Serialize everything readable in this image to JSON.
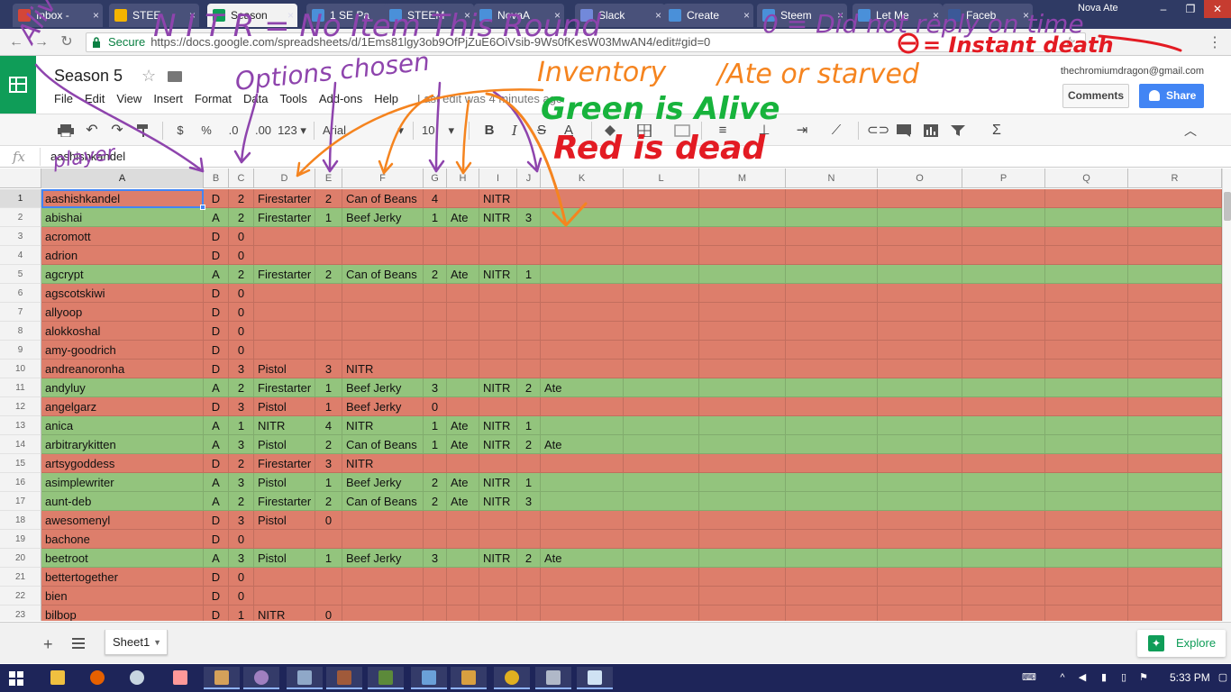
{
  "browser": {
    "tabs": [
      {
        "label": "Inbox -",
        "color": "#d44638"
      },
      {
        "label": "STEE",
        "color": "#f4b400"
      },
      {
        "label": "Season",
        "color": "#0f9d58"
      },
      {
        "label": "1 SE Pa",
        "color": "#4a90d9"
      },
      {
        "label": "STEEM",
        "color": "#4a90d9"
      },
      {
        "label": "NovaA",
        "color": "#4a90d9"
      },
      {
        "label": "Slack",
        "color": "#7289da"
      },
      {
        "label": "Create",
        "color": "#4a90d9"
      },
      {
        "label": "Steem",
        "color": "#4a90d9"
      },
      {
        "label": "Let Me",
        "color": "#4a90d9"
      },
      {
        "label": "Faceb",
        "color": "#3b5998"
      }
    ],
    "window_user": "Nova Ate",
    "secure_label": "Secure",
    "url": "https://docs.google.com/spreadsheets/d/1Ems81lgy3ob9OfPjZuE6OiVsib-9Ws0fKesW03MwAN4/edit#gid=0"
  },
  "docs": {
    "title": "Season 5",
    "menu": [
      "File",
      "Edit",
      "View",
      "Insert",
      "Format",
      "Data",
      "Tools",
      "Add-ons",
      "Help"
    ],
    "last_edit": "Last edit was 4 minutes ago",
    "account": "thechromiumdragon@gmail.com",
    "comments_label": "Comments",
    "share_label": "Share"
  },
  "toolbar": {
    "currency": "$",
    "percent": "%",
    "dec_less": ".0",
    "dec_more": ".00",
    "number_format": "123",
    "font": "Arial",
    "font_size": "10",
    "bold": "B"
  },
  "formula": {
    "fx": "fx",
    "value": "aashishkandel"
  },
  "grid": {
    "columns": [
      "A",
      "B",
      "C",
      "D",
      "E",
      "F",
      "G",
      "H",
      "I",
      "J",
      "K",
      "L",
      "M",
      "N",
      "O",
      "P",
      "Q",
      "R"
    ],
    "colors": {
      "alive": "#93c47d",
      "dead": "#dd7e6b"
    },
    "rows": [
      {
        "n": "1",
        "status": "dead",
        "cells": [
          "aashishkandel",
          "D",
          "2",
          "Firestarter",
          "2",
          "Can of Beans",
          "4",
          "",
          "NITR",
          "",
          ""
        ]
      },
      {
        "n": "2",
        "status": "alive",
        "cells": [
          "abishai",
          "A",
          "2",
          "Firestarter",
          "1",
          "Beef Jerky",
          "1",
          "Ate",
          "NITR",
          "3",
          ""
        ]
      },
      {
        "n": "3",
        "status": "dead",
        "cells": [
          "acromott",
          "D",
          "0",
          "",
          "",
          "",
          "",
          "",
          "",
          "",
          ""
        ]
      },
      {
        "n": "4",
        "status": "dead",
        "cells": [
          "adrion",
          "D",
          "0",
          "",
          "",
          "",
          "",
          "",
          "",
          "",
          ""
        ]
      },
      {
        "n": "5",
        "status": "alive",
        "cells": [
          "agcrypt",
          "A",
          "2",
          "Firestarter",
          "2",
          "Can of Beans",
          "2",
          "Ate",
          "NITR",
          "1",
          ""
        ]
      },
      {
        "n": "6",
        "status": "dead",
        "cells": [
          "agscotskiwi",
          "D",
          "0",
          "",
          "",
          "",
          "",
          "",
          "",
          "",
          ""
        ]
      },
      {
        "n": "7",
        "status": "dead",
        "cells": [
          "allyoop",
          "D",
          "0",
          "",
          "",
          "",
          "",
          "",
          "",
          "",
          ""
        ]
      },
      {
        "n": "8",
        "status": "dead",
        "cells": [
          "alokkoshal",
          "D",
          "0",
          "",
          "",
          "",
          "",
          "",
          "",
          "",
          ""
        ]
      },
      {
        "n": "9",
        "status": "dead",
        "cells": [
          "amy-goodrich",
          "D",
          "0",
          "",
          "",
          "",
          "",
          "",
          "",
          "",
          ""
        ]
      },
      {
        "n": "10",
        "status": "dead",
        "cells": [
          "andreanoronha",
          "D",
          "3",
          "Pistol",
          "3",
          "NITR",
          "",
          "",
          "",
          "",
          ""
        ]
      },
      {
        "n": "11",
        "status": "alive",
        "cells": [
          "andyluy",
          "A",
          "2",
          "Firestarter",
          "1",
          "Beef Jerky",
          "3",
          "",
          "NITR",
          "2",
          "Ate"
        ]
      },
      {
        "n": "12",
        "status": "dead",
        "cells": [
          "angelgarz",
          "D",
          "3",
          "Pistol",
          "1",
          "Beef Jerky",
          "0",
          "",
          "",
          "",
          ""
        ]
      },
      {
        "n": "13",
        "status": "alive",
        "cells": [
          "anica",
          "A",
          "1",
          "NITR",
          "4",
          "NITR",
          "1",
          "Ate",
          "NITR",
          "1",
          ""
        ]
      },
      {
        "n": "14",
        "status": "alive",
        "cells": [
          "arbitrarykitten",
          "A",
          "3",
          "Pistol",
          "2",
          "Can of Beans",
          "1",
          "Ate",
          "NITR",
          "2",
          "Ate"
        ]
      },
      {
        "n": "15",
        "status": "dead",
        "cells": [
          "artsygoddess",
          "D",
          "2",
          "Firestarter",
          "3",
          "NITR",
          "",
          "",
          "",
          "",
          ""
        ]
      },
      {
        "n": "16",
        "status": "alive",
        "cells": [
          "asimplewriter",
          "A",
          "3",
          "Pistol",
          "1",
          "Beef Jerky",
          "2",
          "Ate",
          "NITR",
          "1",
          ""
        ]
      },
      {
        "n": "17",
        "status": "alive",
        "cells": [
          "aunt-deb",
          "A",
          "2",
          "Firestarter",
          "2",
          "Can of Beans",
          "2",
          "Ate",
          "NITR",
          "3",
          ""
        ]
      },
      {
        "n": "18",
        "status": "dead",
        "cells": [
          "awesomenyl",
          "D",
          "3",
          "Pistol",
          "0",
          "",
          "",
          "",
          "",
          "",
          ""
        ]
      },
      {
        "n": "19",
        "status": "dead",
        "cells": [
          "bachone",
          "D",
          "0",
          "",
          "",
          "",
          "",
          "",
          "",
          "",
          ""
        ]
      },
      {
        "n": "20",
        "status": "alive",
        "cells": [
          "beetroot",
          "A",
          "3",
          "Pistol",
          "1",
          "Beef Jerky",
          "3",
          "",
          "NITR",
          "2",
          "Ate"
        ]
      },
      {
        "n": "21",
        "status": "dead",
        "cells": [
          "bettertogether",
          "D",
          "0",
          "",
          "",
          "",
          "",
          "",
          "",
          "",
          ""
        ]
      },
      {
        "n": "22",
        "status": "dead",
        "cells": [
          "bien",
          "D",
          "0",
          "",
          "",
          "",
          "",
          "",
          "",
          "",
          ""
        ]
      },
      {
        "n": "23",
        "status": "dead",
        "cells": [
          "bilbop",
          "D",
          "1",
          "NITR",
          "0",
          "",
          "",
          "",
          "",
          "",
          ""
        ]
      }
    ]
  },
  "sheetbar": {
    "sheet_name": "Sheet1",
    "explore_label": "Explore"
  },
  "taskbar": {
    "clock": "5:33 PM"
  },
  "annotations": {
    "alive_dead": "Alive or Dead",
    "player": "player",
    "nitr": "N I T R = No Item This Round",
    "options": "Options chosen",
    "zero": "0 = Did not reply on time",
    "instant": "= Instant death",
    "inventory": "Inventory",
    "ate_starved": "/Ate or starved",
    "green": "Green is Alive",
    "red": "Red is dead",
    "colors": {
      "purple": "#8e44ad",
      "orange": "#f5841f",
      "green": "#17b33c",
      "red": "#e31b23"
    }
  }
}
